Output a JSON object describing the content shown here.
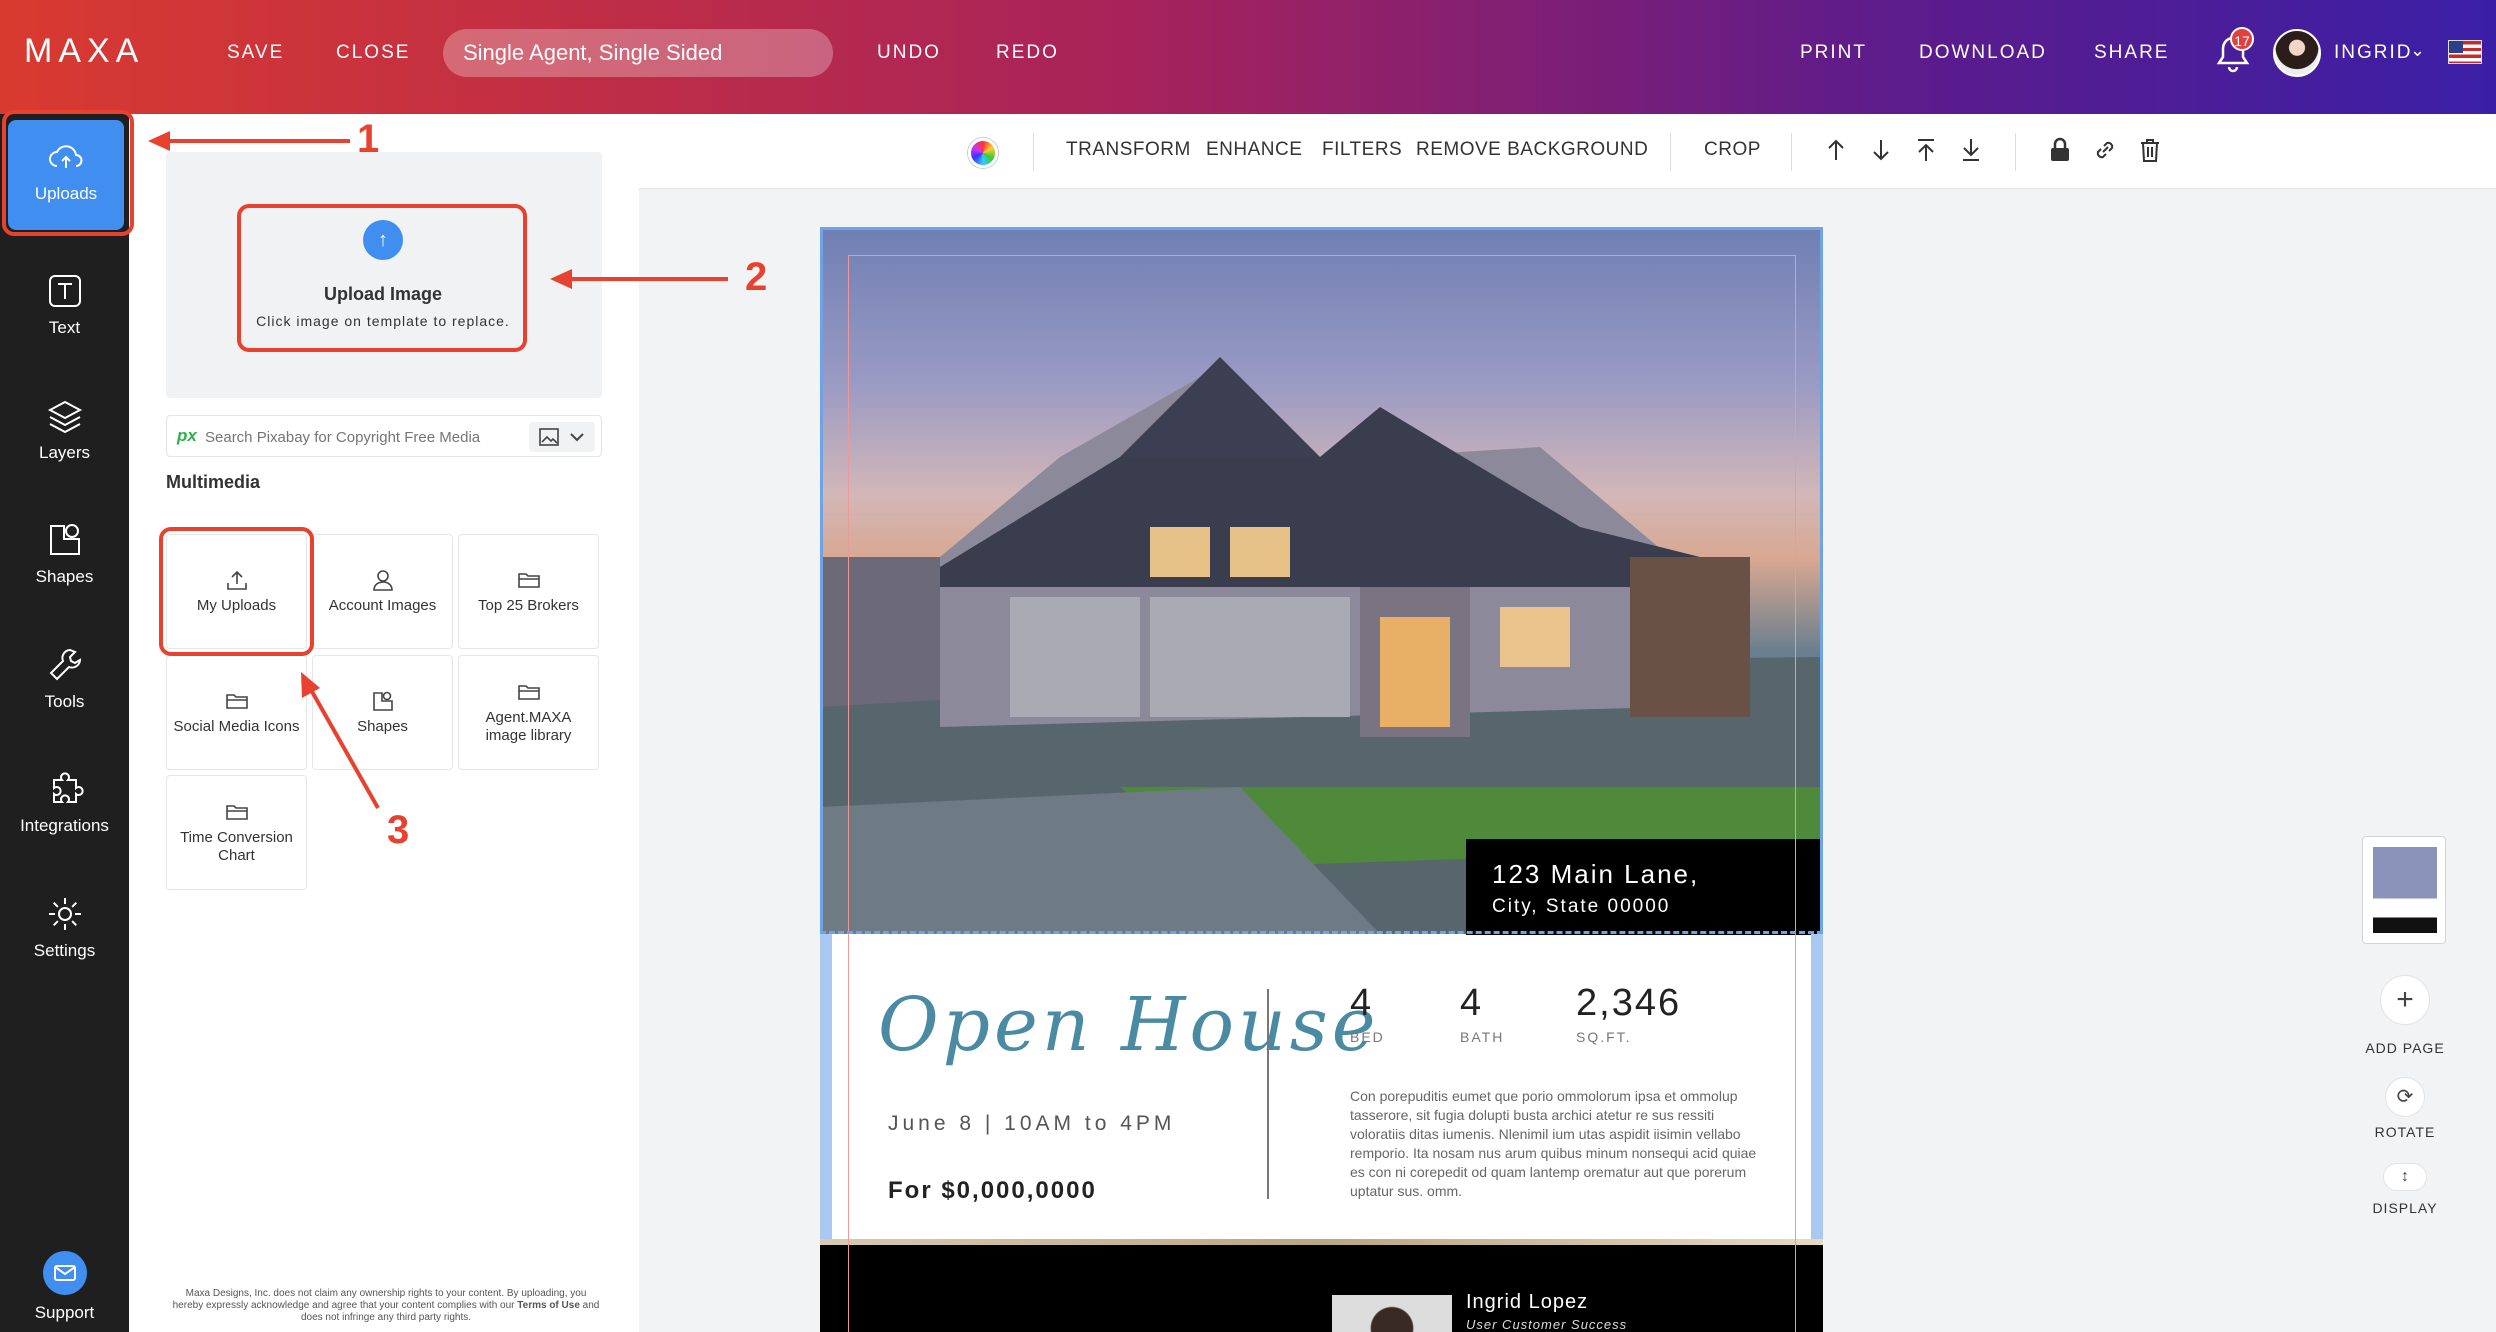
{
  "app": {
    "logo": "MAXA",
    "save_label": "SAVE",
    "close_label": "CLOSE",
    "document_title": "Single Agent, Single Sided",
    "undo_label": "UNDO",
    "redo_label": "REDO",
    "print_label": "PRINT",
    "download_label": "DOWNLOAD",
    "share_label": "SHARE",
    "notification_count": "17",
    "user_name": "INGRID",
    "caret": "⌄"
  },
  "sidebar": {
    "items": [
      {
        "label": "Uploads",
        "icon": "cloud-upload-icon"
      },
      {
        "label": "Text",
        "icon": "text-icon"
      },
      {
        "label": "Layers",
        "icon": "layers-icon"
      },
      {
        "label": "Shapes",
        "icon": "shapes-icon"
      },
      {
        "label": "Tools",
        "icon": "wrench-icon"
      },
      {
        "label": "Integrations",
        "icon": "puzzle-icon"
      },
      {
        "label": "Settings",
        "icon": "gear-icon"
      },
      {
        "label": "Support",
        "icon": "mail-icon"
      }
    ]
  },
  "panel": {
    "upload_title": "Upload Image",
    "upload_subtitle": "Click image on template to replace.",
    "search_icon_text": "px",
    "search_placeholder": "Search Pixabay for Copyright Free Media",
    "multimedia_heading": "Multimedia",
    "tiles": [
      {
        "label": "My Uploads",
        "icon": "upload-icon"
      },
      {
        "label": "Account Images",
        "icon": "person-icon"
      },
      {
        "label": "Top 25 Brokers",
        "icon": "folder-icon"
      },
      {
        "label": "Social Media Icons",
        "icon": "folder-icon"
      },
      {
        "label": "Shapes",
        "icon": "shapes-icon"
      },
      {
        "label": "Agent.MAXA image library",
        "icon": "folder-icon"
      },
      {
        "label": "Time Conversion Chart",
        "icon": "folder-icon"
      }
    ],
    "disclaimer_1": "Maxa Designs, Inc. does not claim any ownership rights to your content. By uploading, you hereby expressly acknowledge and agree that your content complies with our ",
    "disclaimer_link": "Terms of Use",
    "disclaimer_2": " and does not infringe any third party rights."
  },
  "toolbar": {
    "transform_label": "TRANSFORM",
    "enhance_label": "ENHANCE",
    "filters_label": "FILTERS",
    "remove_bg_label": "REMOVE BACKGROUND",
    "crop_label": "CROP"
  },
  "flyer": {
    "address_line1": "123 Main Lane,",
    "address_line2": "City, State 00000",
    "headline": "Open House",
    "event_date": "June 8  |  10AM to 4PM",
    "price": "For $0,000,0000",
    "stats": [
      {
        "value": "4",
        "label": "BED"
      },
      {
        "value": "4",
        "label": "BATH"
      },
      {
        "value": "2,346",
        "label": "SQ.FT."
      }
    ],
    "description": "Con porepuditis eumet que porio ommolorum ipsa et ommolup tasserore, sit fugia dolupti busta archici atetur re sus ressiti voloratiis ditas iumenis. Nlenimil ium utas aspidit iisimin vellabo remporio. Ita nosam nus arum quibus minum nonsequi acid quiae es con ni corepedit od quam lantemp orematur aut que porerum uptatur sus. omm.",
    "agent_name": "Ingrid Lopez",
    "agent_title": "User Customer Success"
  },
  "right_panel": {
    "add_page_label": "ADD PAGE",
    "rotate_label": "ROTATE",
    "display_label": "DISPLAY"
  },
  "annotations": {
    "one": "1",
    "two": "2",
    "three": "3"
  },
  "colors": {
    "accent": "#3f8ef0",
    "annotation_red": "#e8412f",
    "headline_teal": "#4a8aa3"
  }
}
